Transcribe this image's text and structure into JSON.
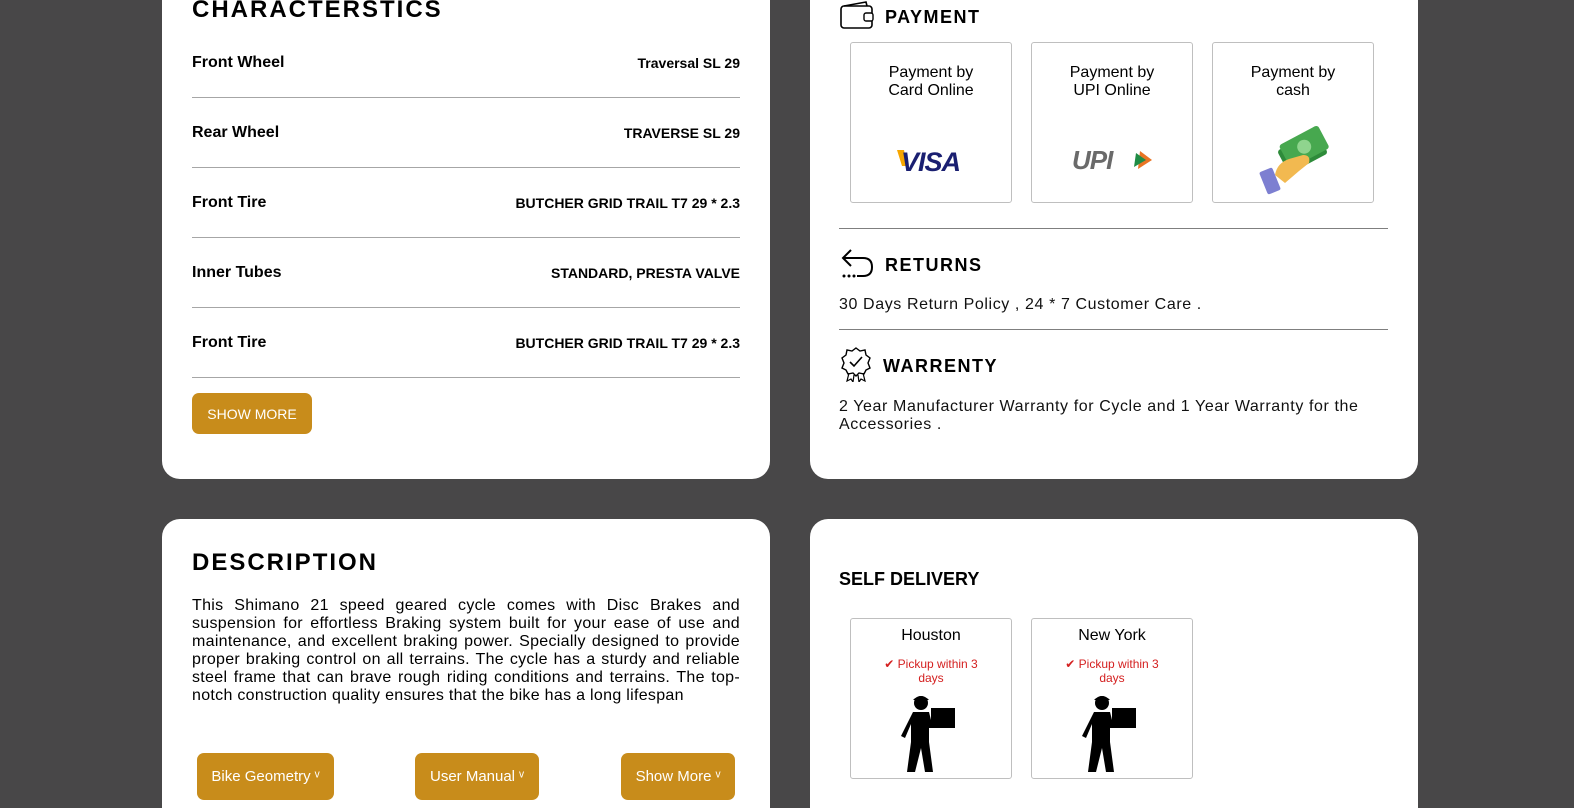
{
  "characteristics": {
    "title": "CHARACTERSTICS",
    "rows": [
      {
        "label": "Front Wheel",
        "value": "Traversal SL 29"
      },
      {
        "label": "Rear Wheel",
        "value": "TRAVERSE SL 29"
      },
      {
        "label": "Front Tire",
        "value": "BUTCHER GRID TRAIL T7 29 * 2.3"
      },
      {
        "label": "Inner Tubes",
        "value": "STANDARD, PRESTA VALVE"
      },
      {
        "label": "Front Tire",
        "value": "BUTCHER GRID TRAIL T7 29 * 2.3"
      }
    ],
    "show_more_label": "SHOW MORE"
  },
  "payment": {
    "title": "PAYMENT",
    "options": [
      {
        "label": "Payment by Card Online",
        "brand": "VISA",
        "icon": "visa-logo"
      },
      {
        "label": "Payment by UPI Online",
        "brand": "UPI",
        "icon": "upi-logo"
      },
      {
        "label": "Payment by cash",
        "icon": "cash-hand-icon"
      }
    ]
  },
  "returns": {
    "title": "RETURNS",
    "text": "30 Days Return Policy , 24 * 7 Customer Care ."
  },
  "warranty": {
    "title": "WARRENTY",
    "text": "2 Year Manufacturer Warranty for Cycle and 1 Year Warranty for the Accessories ."
  },
  "description": {
    "title": "DESCRIPTION",
    "text": "This Shimano 21 speed geared cycle comes with Disc Brakes and suspension for effortless Braking system built for your ease of use and maintenance, and excellent braking power. Specially designed to provide proper braking control on all terrains. The cycle has a sturdy and reliable steel frame that can brave rough riding conditions and terrains. The top-notch construction quality ensures that the bike has a long lifespan",
    "buttons": [
      "Bike Geometry ᵛ",
      "User Manual ᵛ",
      "Show More ᵛ"
    ]
  },
  "self_delivery": {
    "title": "SELF DELIVERY",
    "locations": [
      {
        "city": "Houston",
        "pickup": "✔ Pickup within 3 days"
      },
      {
        "city": "New York",
        "pickup": "✔ Pickup within 3 days"
      }
    ]
  },
  "colors": {
    "background": "#484748",
    "card": "#ffffff",
    "accent_gold": "#c88c1b",
    "pickup_red": "#d42020",
    "visa_blue": "#1a1f71",
    "visa_gold": "#f7a600"
  }
}
